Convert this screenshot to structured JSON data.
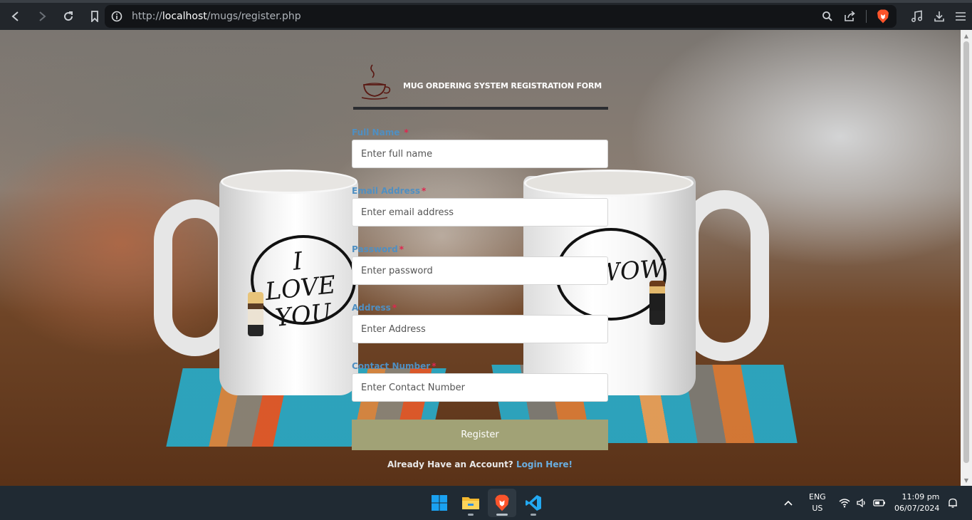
{
  "browser": {
    "url_prefix": "http://",
    "url_host": "localhost",
    "url_path": "/mugs/register.php"
  },
  "background": {
    "left_mug_text": "I LOVE YOU",
    "right_mug_text": "WOW"
  },
  "form": {
    "title": "MUG ORDERING SYSTEM REGISTRATION FORM",
    "required_mark": "*",
    "fields": [
      {
        "label": "Full Name",
        "placeholder": "Enter full name"
      },
      {
        "label": "Email Address",
        "placeholder": "Enter email address"
      },
      {
        "label": "Password",
        "placeholder": "Enter password"
      },
      {
        "label": "Address",
        "placeholder": "Enter Address"
      },
      {
        "label": "Contact Number",
        "placeholder": "Enter Contact Number"
      }
    ],
    "register_label": "Register",
    "login_prompt": "Already Have an Account?",
    "login_link": "Login Here!"
  },
  "taskbar": {
    "language": "ENG",
    "region": "US",
    "time": "11:09 pm",
    "date": "06/07/2024"
  },
  "colors": {
    "label_blue": "#4f8fc2",
    "required_red": "#e0264f",
    "register_button": "#a1a276",
    "link_blue": "#6aaee0"
  }
}
